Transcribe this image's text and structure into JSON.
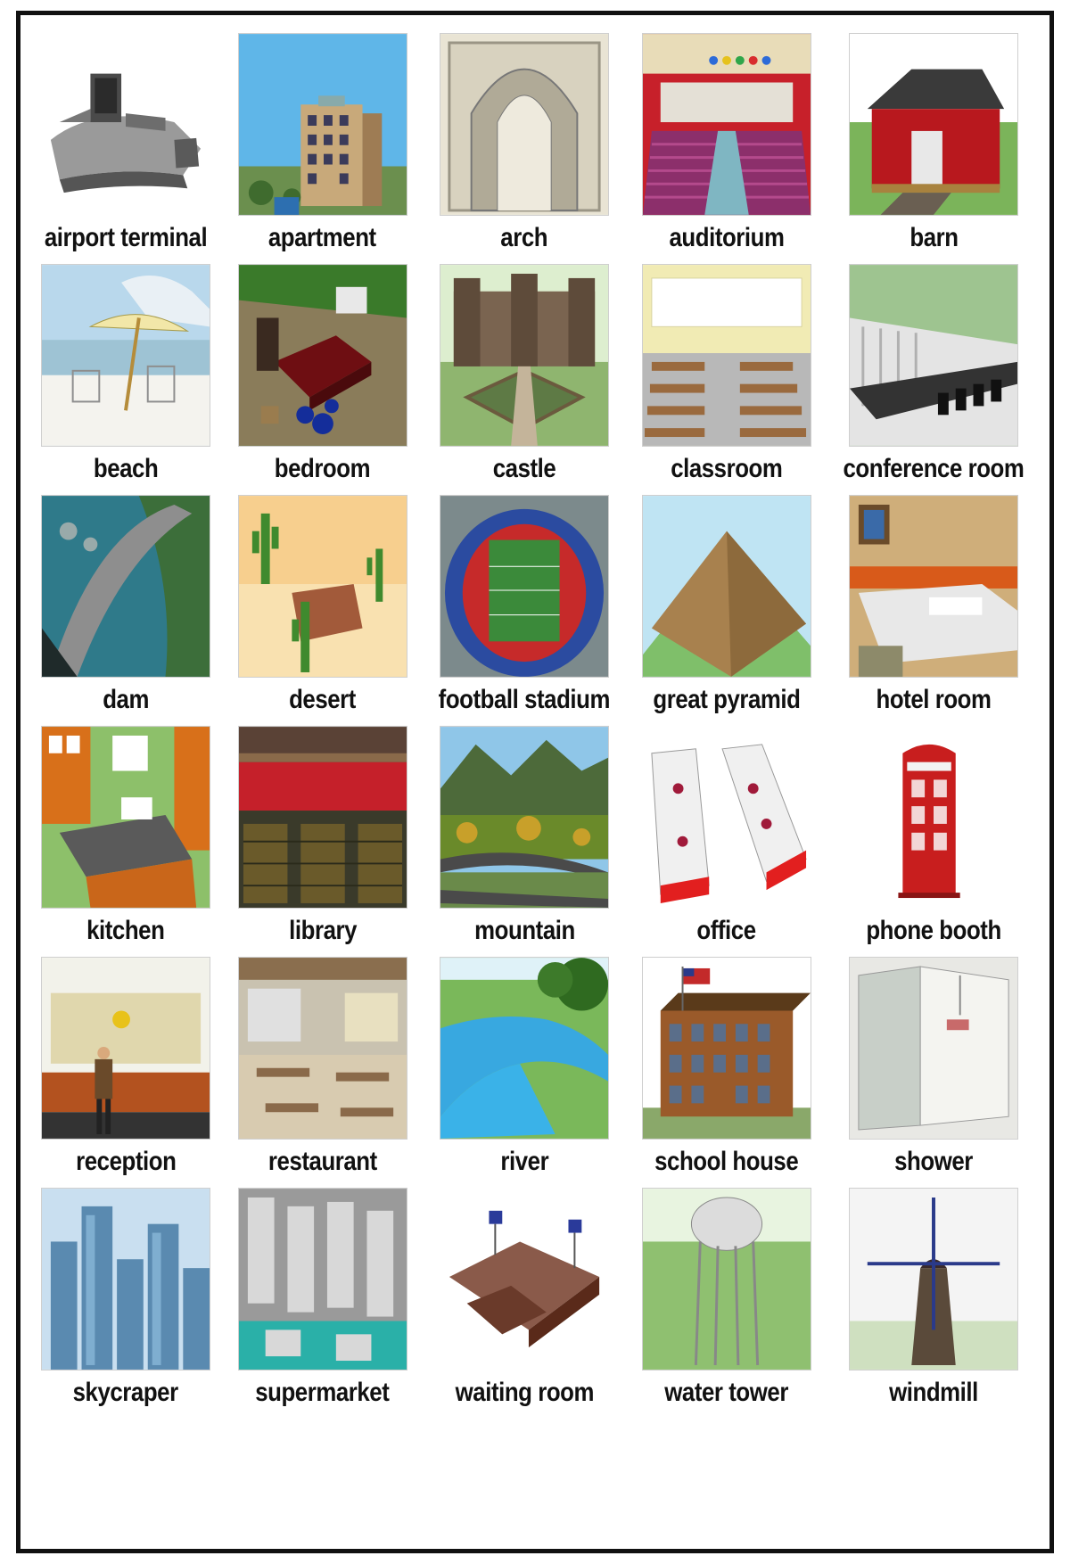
{
  "scenes": [
    {
      "label": "airport terminal",
      "icon": "airport-terminal-icon"
    },
    {
      "label": "apartment",
      "icon": "apartment-icon"
    },
    {
      "label": "arch",
      "icon": "arch-icon"
    },
    {
      "label": "auditorium",
      "icon": "auditorium-icon"
    },
    {
      "label": "barn",
      "icon": "barn-icon"
    },
    {
      "label": "beach",
      "icon": "beach-icon"
    },
    {
      "label": "bedroom",
      "icon": "bedroom-icon"
    },
    {
      "label": "castle",
      "icon": "castle-icon"
    },
    {
      "label": "classroom",
      "icon": "classroom-icon"
    },
    {
      "label": "conference room",
      "icon": "conference-room-icon"
    },
    {
      "label": "dam",
      "icon": "dam-icon"
    },
    {
      "label": "desert",
      "icon": "desert-icon"
    },
    {
      "label": "football stadium",
      "icon": "football-stadium-icon"
    },
    {
      "label": "great pyramid",
      "icon": "great-pyramid-icon"
    },
    {
      "label": "hotel room",
      "icon": "hotel-room-icon"
    },
    {
      "label": "kitchen",
      "icon": "kitchen-icon"
    },
    {
      "label": "library",
      "icon": "library-icon"
    },
    {
      "label": "mountain",
      "icon": "mountain-icon"
    },
    {
      "label": "office",
      "icon": "office-icon"
    },
    {
      "label": "phone booth",
      "icon": "phone-booth-icon"
    },
    {
      "label": "reception",
      "icon": "reception-icon"
    },
    {
      "label": "restaurant",
      "icon": "restaurant-icon"
    },
    {
      "label": "river",
      "icon": "river-icon"
    },
    {
      "label": "school house",
      "icon": "school-house-icon"
    },
    {
      "label": "shower",
      "icon": "shower-icon"
    },
    {
      "label": "skycraper",
      "icon": "skyscraper-icon"
    },
    {
      "label": "supermarket",
      "icon": "supermarket-icon"
    },
    {
      "label": "waiting room",
      "icon": "waiting-room-icon"
    },
    {
      "label": "water tower",
      "icon": "water-tower-icon"
    },
    {
      "label": "windmill",
      "icon": "windmill-icon"
    }
  ]
}
